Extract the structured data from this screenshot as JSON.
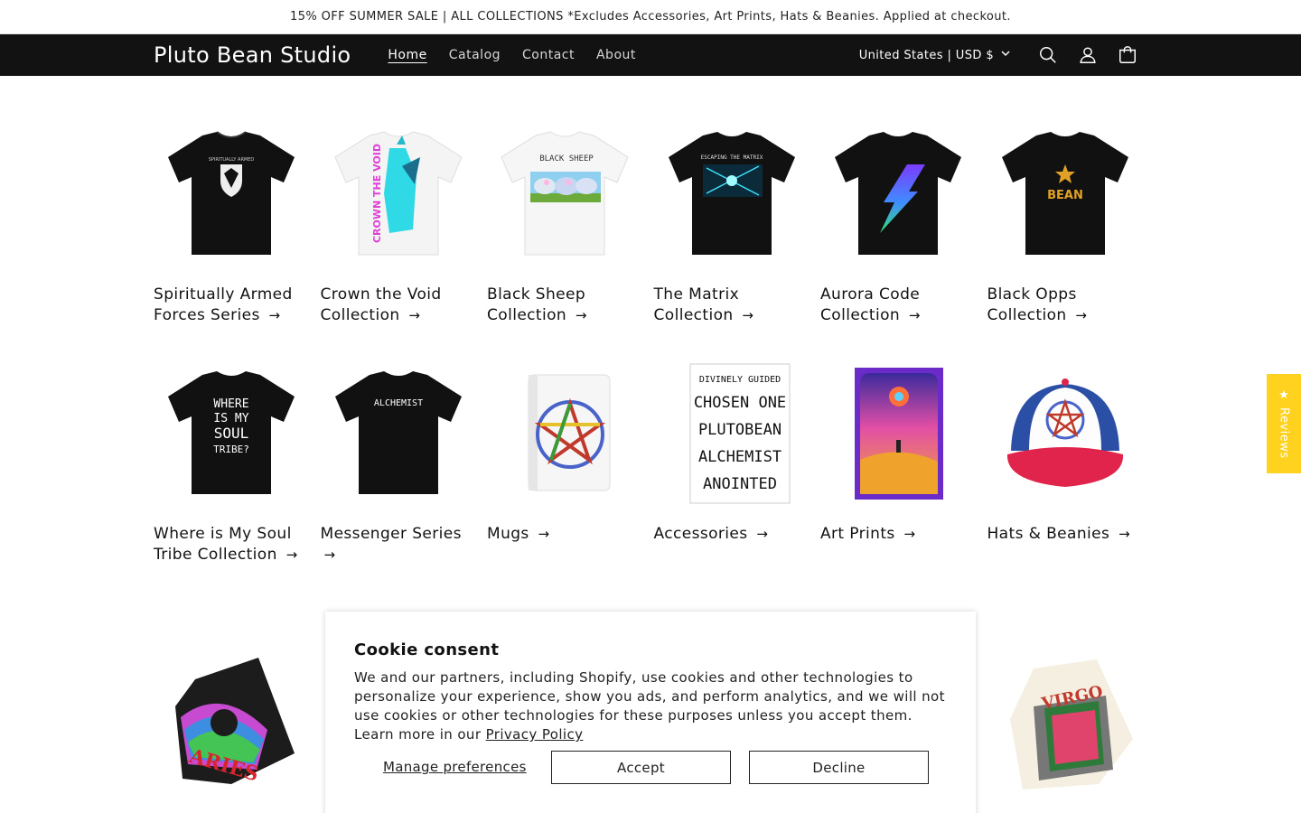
{
  "announcement": "15% OFF SUMMER SALE | ALL COLLECTIONS *Excludes Accessories, Art Prints, Hats & Beanies. Applied at checkout.",
  "header": {
    "logo": "Pluto Bean Studio",
    "nav": [
      {
        "label": "Home",
        "active": true
      },
      {
        "label": "Catalog"
      },
      {
        "label": "Contact"
      },
      {
        "label": "About"
      }
    ],
    "country": "United States | USD $",
    "icons": [
      "search-icon",
      "account-icon",
      "cart-icon"
    ]
  },
  "collections": [
    {
      "title": "Spiritually Armed Forces Series",
      "shirt_color": "#111111",
      "graphic": "eagle-crest"
    },
    {
      "title": "Crown the Void Collection",
      "shirt_color": "#f6f6f6",
      "graphic": "cyan-statue"
    },
    {
      "title": "Black Sheep Collection",
      "shirt_color": "#f6f6f6",
      "graphic": "sheep"
    },
    {
      "title": "The Matrix Collection",
      "shirt_color": "#111111",
      "graphic": "matrix"
    },
    {
      "title": "Aurora Code Collection",
      "shirt_color": "#111111",
      "graphic": "lightning"
    },
    {
      "title": "Black Opps Collection",
      "shirt_color": "#111111",
      "graphic": "star-bean"
    },
    {
      "title": "Where is My Soul Tribe Collection",
      "shirt_color": "#111111",
      "graphic": "soul-tribe-text"
    },
    {
      "title": "Messenger Series",
      "shirt_color": "#111111",
      "graphic": "alchemist-text"
    },
    {
      "title": "Mugs",
      "graphic": "pentagram-mug"
    },
    {
      "title": "Accessories",
      "graphic": "sticker"
    },
    {
      "title": "Art Prints",
      "graphic": "art-print"
    },
    {
      "title": "Hats & Beanies",
      "graphic": "trucker-hat"
    }
  ],
  "shirt_texts": {
    "eagle_label": "SPIRITUALLY ARMED",
    "crown_text": "CROWN THE VOID",
    "sheep_text": "BLACK SHEEP",
    "matrix_text": "ESCAPING THE MATRIX",
    "bean_text": "BEAN",
    "soul_lines": [
      "WHERE",
      "IS MY",
      "SOUL",
      "TRIBE?"
    ],
    "alchemist_text": "ALCHEMIST",
    "sticker_lines": [
      "DIVINELY GUIDED",
      "CHOSEN ONE",
      "PLUTOBEAN",
      "ALCHEMIST",
      "ANOINTED"
    ],
    "aries_text": "ARIES",
    "virgo_text": "VIRGO"
  },
  "arrow": "→",
  "cookie": {
    "title": "Cookie consent",
    "body": "We and our partners, including Shopify, use cookies and other technologies to personalize your experience, show you ads, and perform analytics, and we will not use cookies or other technologies for these purposes unless you accept them. Learn more in our ",
    "link": "Privacy Policy",
    "manage": "Manage preferences",
    "accept": "Accept",
    "decline": "Decline"
  },
  "reviews_tab": {
    "star": "★",
    "label": "Reviews",
    "color": "#ffd21f"
  }
}
